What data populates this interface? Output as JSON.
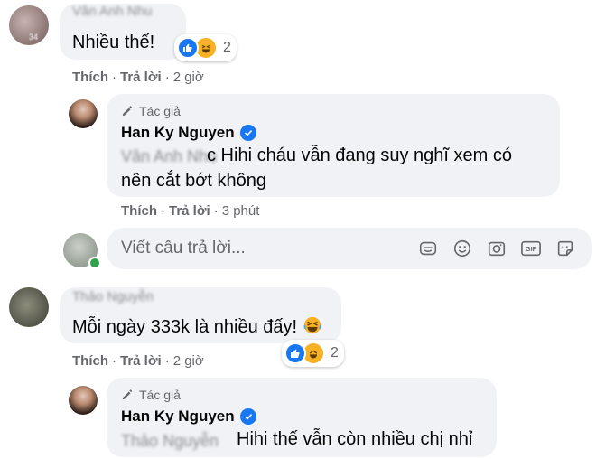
{
  "comments": [
    {
      "commenter": "Vân Anh Nhu",
      "text": "Nhiều thế!",
      "reaction_count": "2",
      "actions": {
        "like": "Thích",
        "reply": "Trả lời",
        "time": "2 giờ"
      },
      "reply": {
        "author_badge": "Tác giả",
        "author_name": "Han Ky Nguyen",
        "mention": "Vân Anh Nhu",
        "text_line1": "c Hihi cháu vẫn đang suy nghĩ xem có",
        "text_line2": "nên cắt bớt không",
        "actions": {
          "like": "Thích",
          "reply": "Trả lời",
          "time": "3 phút"
        }
      }
    },
    {
      "commenter": "Thảo Nguyễn",
      "text": "Mỗi ngày 333k là nhiều đấy!",
      "reaction_count": "2",
      "actions": {
        "like": "Thích",
        "reply": "Trả lời",
        "time": "2 giờ"
      },
      "reply": {
        "author_badge": "Tác giả",
        "author_name": "Han Ky Nguyen",
        "mention": "Thảo Nguyễn",
        "text_line1": "Hihi thế vẫn còn nhiều chị nhỉ"
      }
    }
  ],
  "reply_input": {
    "placeholder": "Viết câu trả lời..."
  },
  "toolbar_icons": [
    "sticker-icon",
    "emoji-icon",
    "camera-icon",
    "gif-icon",
    "avatar-sticker-icon"
  ],
  "colors": {
    "bubble": "#f0f2f5",
    "secondary_text": "#65676b",
    "accent": "#1877f2",
    "haha": "#f7b125",
    "online": "#31a24c"
  }
}
